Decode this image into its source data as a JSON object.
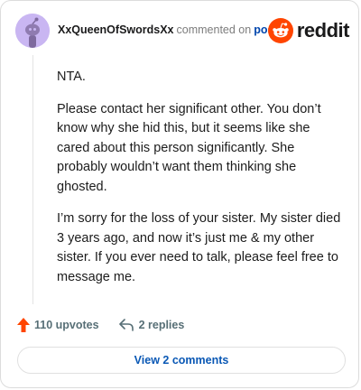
{
  "comment": {
    "username": "XxQueenOfSwordsXx",
    "action_text": "commented on",
    "post_link_label": "post",
    "brand": "reddit",
    "paragraphs": [
      "NTA.",
      "Please contact her significant other. You don’t know why she hid this, but it seems like she cared about this person significantly. She probably wouldn’t want them thinking she ghosted.",
      "I’m sorry for the loss of your sister. My sister died 3 years ago, and now it’s just me & my other sister. If you ever need to talk, please feel free to message me."
    ],
    "upvotes_label": "110 upvotes",
    "replies_label": "2 replies",
    "view_comments_label": "View 2 comments"
  },
  "colors": {
    "brand_orange": "#ff4500",
    "avatar_bg": "#c9b6f2",
    "link_blue": "#0045ac",
    "muted": "#576f76"
  },
  "icons": {
    "avatar": "snoo-avatar-icon",
    "brand": "reddit-logo-icon",
    "upvote": "upvote-arrow-icon",
    "reply": "reply-arrow-icon"
  }
}
